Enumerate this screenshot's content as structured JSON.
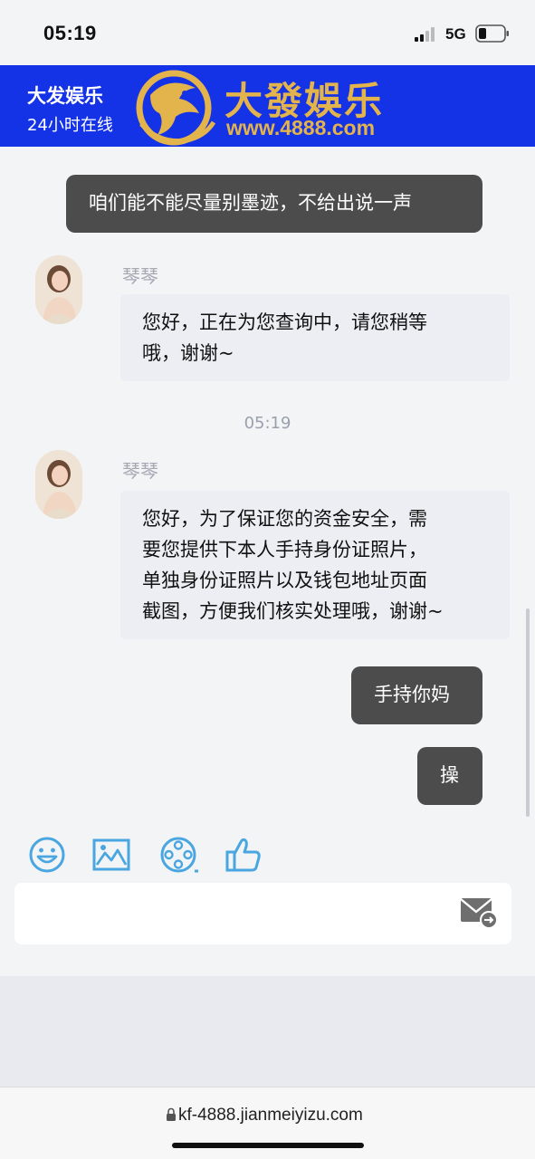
{
  "status_bar": {
    "time": "05:19",
    "network": "5G"
  },
  "header": {
    "title": "大发娱乐",
    "subtitle": "24小时在线",
    "logo_name": "大發娛乐",
    "logo_url": "www.4888.com",
    "background_color": "#1432e6",
    "logo_color": "#e3b34c"
  },
  "messages": [
    {
      "sender": "user",
      "text": "咱们能不能尽量别墨迹，不给出说一声"
    },
    {
      "sender": "agent",
      "name": "琴琴",
      "lines": [
        "您好，正在为您查询中，请您稍等",
        "哦，谢谢~"
      ]
    },
    {
      "timestamp": "05:19"
    },
    {
      "sender": "agent",
      "name": "琴琴",
      "lines": [
        "您好，为了保证您的资金安全，需",
        "要您提供下本人手持身份证照片，",
        "单独身份证照片以及钱包地址页面",
        "截图，方便我们核实处理哦，谢谢~"
      ]
    },
    {
      "sender": "user",
      "text": "手持你妈"
    },
    {
      "sender": "user",
      "text": "操"
    }
  ],
  "toolbar": {
    "icons": [
      "emoji-icon",
      "image-icon",
      "video-icon",
      "thumbs-up-icon"
    ],
    "icon_color": "#4aa6e0"
  },
  "composer": {
    "value": "",
    "send_icon": "mail-send-icon"
  },
  "browser": {
    "url": "kf-4888.jianmeiyizu.com"
  }
}
